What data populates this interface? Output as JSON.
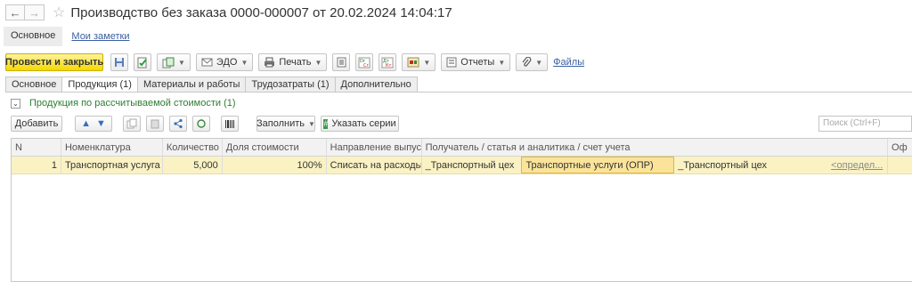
{
  "window": {
    "title": "Производство без заказа 0000-000007 от 20.02.2024 14:04:17"
  },
  "nav": {
    "back": "←",
    "forward": "→",
    "star": "☆"
  },
  "subnav": {
    "main": "Основное",
    "notes": "Мои заметки"
  },
  "toolbar": {
    "post_close": "Провести и закрыть",
    "edo": "ЭДО",
    "print": "Печать",
    "dt_top": "Дт",
    "dt_bottom": "Кт",
    "reports": "Отчеты",
    "files": "Файлы"
  },
  "tabs": [
    "Основное",
    "Продукция (1)",
    "Материалы и работы",
    "Трудозатраты (1)",
    "Дополнительно"
  ],
  "group": {
    "label": "Продукция по рассчитываемой стоимости (1)"
  },
  "table_toolbar": {
    "add": "Добавить",
    "fill": "Заполнить",
    "series": "Указать серии",
    "search_placeholder": "Поиск (Ctrl+F)"
  },
  "table": {
    "columns": [
      "N",
      "Номенклатура",
      "Количество",
      "Доля стоимости",
      "Направление выпуска",
      "Получатель / статья и аналитика / счет учета",
      "Оф"
    ],
    "rows": [
      {
        "n": "1",
        "item": "Транспортная услуга",
        "qty": "5,000",
        "share": "100%",
        "direction": "Списать на расходы",
        "recipient": "_Транспортный цех",
        "article": "Транспортные услуги (ОПР)",
        "analytics": "_Транспортный цех",
        "account": "<определ..."
      }
    ]
  },
  "colors": {
    "primary_button": "#f5d800",
    "row_highlight": "#fbf2c4",
    "group_text": "#2e7d32",
    "link": "#3a5fa0"
  }
}
